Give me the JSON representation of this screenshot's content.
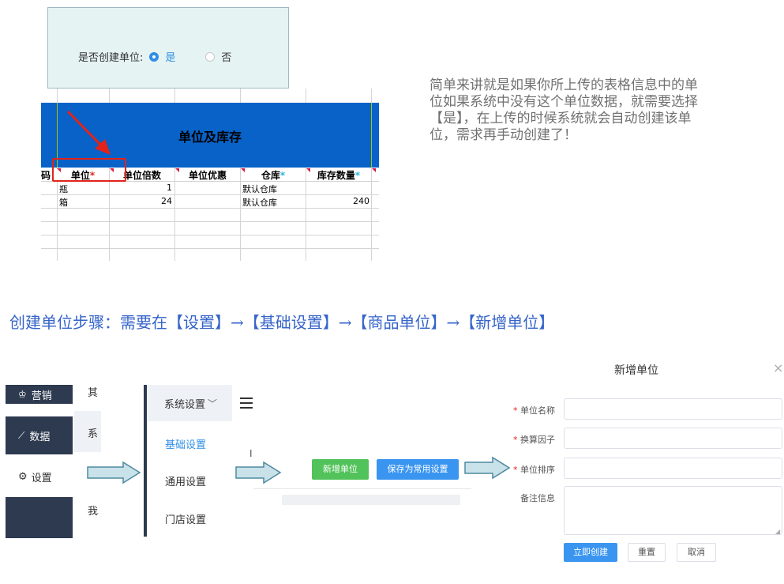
{
  "radio_popup": {
    "question": "是否创建单位:",
    "option_yes": "是",
    "option_no": "否"
  },
  "sheet": {
    "title": "单位及库存",
    "first_col_fragment": "码",
    "columns": [
      "单位",
      "单位倍数",
      "单位优惠",
      "仓库",
      "库存数量"
    ],
    "rows": [
      {
        "unit": "瓶",
        "multiple": "1",
        "discount": "",
        "warehouse": "默认仓库",
        "stock": ""
      },
      {
        "unit": "箱",
        "multiple": "24",
        "discount": "",
        "warehouse": "默认仓库",
        "stock": "240"
      }
    ],
    "required_mark": "*"
  },
  "explanation": "简单来讲就是如果你所上传的表格信息中的单位如果系统中没有这个单位数据，就需要选择【是】，在上传的时候系统就会自动创建该单位，需求再手动创建了！",
  "steps_heading": "创建单位步骤：需要在【设置】→【基础设置】→【商品单位】→【新增单位】",
  "panel1": {
    "menu": [
      "营销",
      "数据",
      "设置"
    ],
    "sub_fragments": [
      "其",
      "系",
      "我"
    ]
  },
  "panel2": {
    "dropdown": "系统设置",
    "items": [
      "基础设置",
      "通用设置",
      "门店设置"
    ]
  },
  "panel3": {
    "cursor_char": "I",
    "add_button": "新增单位",
    "save_button": "保存为常用设置"
  },
  "dialog": {
    "title": "新增单位",
    "close": "×",
    "fields": [
      {
        "label": "单位名称",
        "required": true
      },
      {
        "label": "换算因子",
        "required": true
      },
      {
        "label": "单位排序",
        "required": true
      },
      {
        "label": "备注信息",
        "required": false
      }
    ],
    "required_mark": "*",
    "create_button": "立即创建",
    "reset_button": "重置",
    "cancel_button": "取消"
  },
  "colors": {
    "primary": "#2f8fe6",
    "sheet_header": "#0862c8",
    "sidebar_dark": "#2d3a4f",
    "green_button": "#52c25a",
    "blue_button": "#3a95f0",
    "arrow_fill": "#c9e1e8",
    "arrow_stroke": "#4e8aa1",
    "annotation_red": "#e2231a",
    "heading_blue": "#3564c9"
  }
}
